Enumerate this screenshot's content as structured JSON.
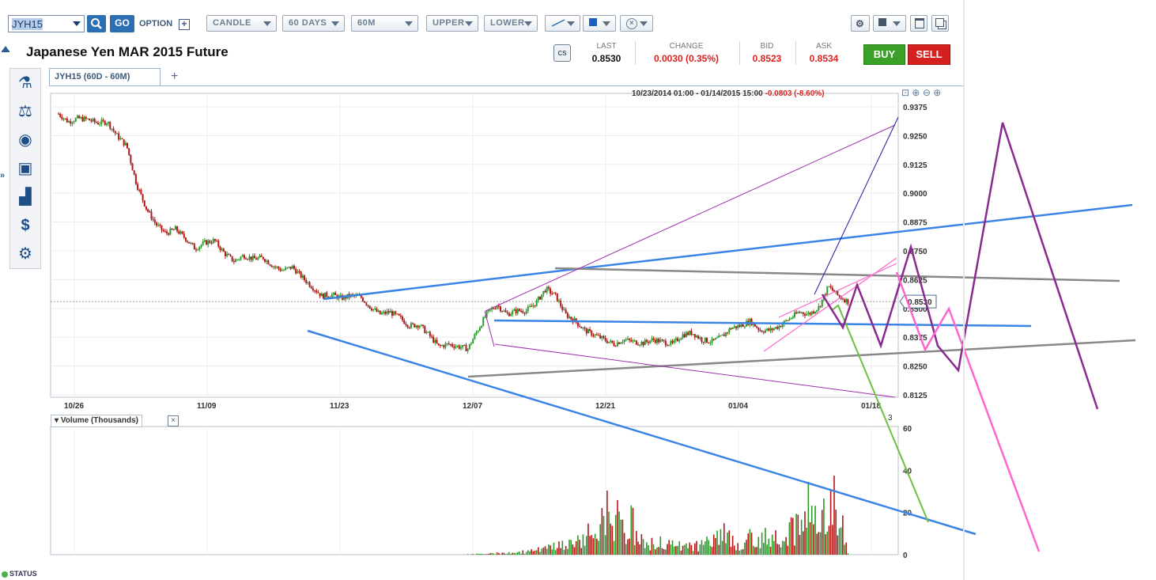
{
  "toolbar": {
    "symbol": "JYH15",
    "go_label": "GO",
    "option_label": "OPTION",
    "chart_type": "CANDLE",
    "period": "60 DAYS",
    "interval": "60M",
    "upper": "UPPER",
    "lower": "LOWER"
  },
  "instrument": {
    "title": "Japanese Yen MAR 2015 Future"
  },
  "quote": {
    "last_label": "LAST",
    "last": "0.8530",
    "change_label": "CHANGE",
    "change": "0.0030 (0.35%)",
    "bid_label": "BID",
    "bid": "0.8523",
    "ask_label": "ASK",
    "ask": "0.8534",
    "buy": "BUY",
    "sell": "SELL"
  },
  "tab": {
    "label": "JYH15 (60D - 60M)"
  },
  "chart_header": {
    "range": "10/23/2014 01:00 - 01/14/2015 15:00",
    "change": "-0.0803 (-8.60%)"
  },
  "volume_panel": {
    "label": "Volume (Thousands)",
    "count": "3"
  },
  "status": "STATUS",
  "colors": {
    "up": "#2a9a2a",
    "down": "#b01818",
    "accent": "#2c6fb2",
    "buy": "#3aa028",
    "sell": "#d62020"
  },
  "chart_data": {
    "type": "line",
    "x_ticks": [
      "10/26",
      "11/09",
      "11/23",
      "12/07",
      "12/21",
      "01/04",
      "01/18"
    ],
    "y_ticks": [
      0.9375,
      0.925,
      0.9125,
      0.9,
      0.8875,
      0.875,
      0.8625,
      0.85,
      0.8375,
      0.825,
      0.8125
    ],
    "y_tick_labels": [
      "0.9375",
      "0.9250",
      "0.9125",
      "0.9000",
      "0.8875",
      "0.8750",
      "0.8625",
      "0.8500",
      "0.8375",
      "0.8250",
      "0.8125"
    ],
    "ylim": [
      0.8125,
      0.9375
    ],
    "last_price_label": "0.8530",
    "price_path_days": [
      0,
      1,
      2,
      3,
      4,
      5,
      6,
      7,
      8,
      9,
      10,
      11,
      12,
      13,
      14,
      15,
      16,
      17,
      18,
      19,
      20,
      21,
      22,
      23,
      24,
      25,
      26,
      27,
      28,
      29,
      30,
      31,
      32,
      33,
      34,
      35,
      36,
      37,
      38,
      39,
      40,
      41,
      42,
      43,
      44,
      45,
      46,
      47,
      48,
      49,
      50,
      51,
      52,
      53,
      54,
      55,
      56,
      57,
      58,
      59,
      60,
      61,
      62,
      63,
      64,
      65,
      66,
      67,
      68,
      69,
      70,
      71,
      72,
      73,
      74,
      75,
      76,
      77,
      78,
      79,
      80,
      81
    ],
    "price_path": [
      0.9345,
      0.931,
      0.9325,
      0.932,
      0.9305,
      0.931,
      0.925,
      0.9205,
      0.904,
      0.8935,
      0.8865,
      0.8825,
      0.8845,
      0.8805,
      0.876,
      0.8785,
      0.8795,
      0.874,
      0.8705,
      0.873,
      0.8715,
      0.872,
      0.8685,
      0.8665,
      0.868,
      0.8635,
      0.8595,
      0.8555,
      0.856,
      0.8545,
      0.8555,
      0.855,
      0.8505,
      0.8475,
      0.8485,
      0.846,
      0.8425,
      0.843,
      0.8385,
      0.8335,
      0.8345,
      0.8335,
      0.8325,
      0.8405,
      0.848,
      0.8515,
      0.8475,
      0.849,
      0.849,
      0.8525,
      0.8585,
      0.8555,
      0.8475,
      0.8445,
      0.8405,
      0.8385,
      0.8365,
      0.8345,
      0.8365,
      0.8355,
      0.835,
      0.8365,
      0.8355,
      0.8345,
      0.8385,
      0.8395,
      0.8365,
      0.8355,
      0.8375,
      0.8415,
      0.8425,
      0.8445,
      0.8405,
      0.8405,
      0.8425,
      0.8455,
      0.8485,
      0.8475,
      0.8505,
      0.8595,
      0.8555,
      0.853
    ],
    "volume_ylim": [
      0,
      60
    ],
    "volume_ticks": [
      "60",
      "40",
      "20",
      "0"
    ],
    "volume_path_days": [
      0,
      5,
      10,
      15,
      20,
      25,
      30,
      35,
      40,
      45,
      48,
      50,
      52,
      54,
      56,
      58,
      60,
      62,
      64,
      66,
      68,
      70,
      72,
      74,
      76,
      78,
      80,
      81
    ],
    "volume_path": [
      0,
      0,
      0,
      0,
      0,
      0,
      0,
      0,
      0,
      1,
      3,
      6,
      10,
      15,
      32,
      28,
      12,
      10,
      9,
      10,
      18,
      12,
      16,
      22,
      30,
      45,
      53,
      1
    ]
  }
}
